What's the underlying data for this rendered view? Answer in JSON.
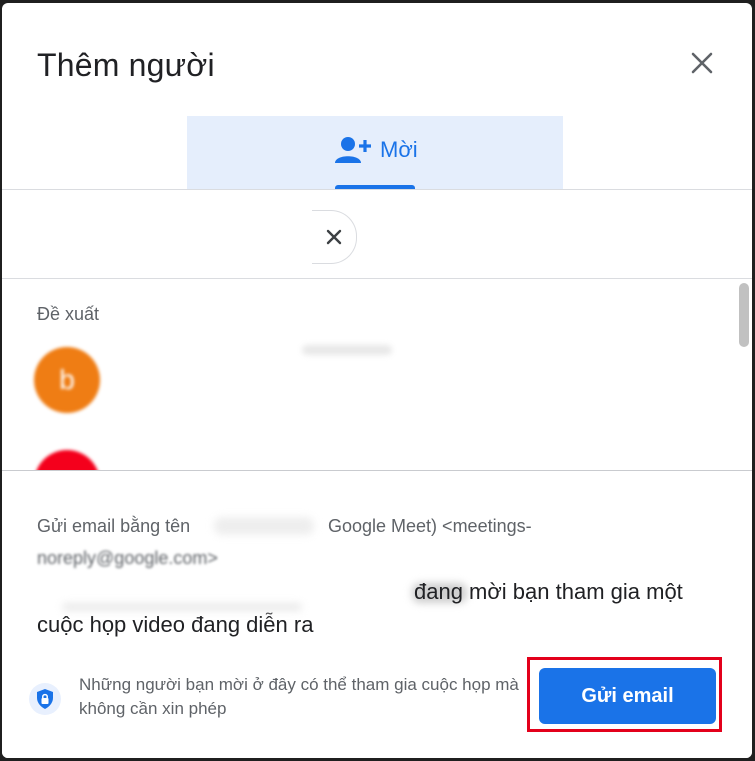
{
  "dialog": {
    "title": "Thêm người",
    "close_icon": "close-icon"
  },
  "tabs": [
    {
      "label": "Mời",
      "icon": "person-add-icon",
      "active": true
    }
  ],
  "search": {
    "clear_icon": "close-icon"
  },
  "suggestions": {
    "heading": "Đề xuất",
    "items": [
      {
        "avatar_letter": "b",
        "avatar_color": "#ef7d14"
      },
      {
        "avatar_letter": "",
        "avatar_color": "#f4001c"
      }
    ]
  },
  "email_preview": {
    "sender_part1": "Gửi email bằng tên",
    "sender_part2": "Google Meet) <meetings-",
    "sender_part3": "noreply@google.com>",
    "message_part1": "đang mời bạn tham gia một",
    "message_part2": "cuộc họp video đang diễn ra"
  },
  "footer": {
    "info_text": "Những người bạn mời ở đây có thể tham gia cuộc họp mà không cần xin phép",
    "send_label": "Gửi email",
    "lock_icon": "lock-shield-icon"
  },
  "colors": {
    "accent": "#1a73e8",
    "highlight": "#e3001b",
    "tab_bg": "#e5eefc"
  }
}
